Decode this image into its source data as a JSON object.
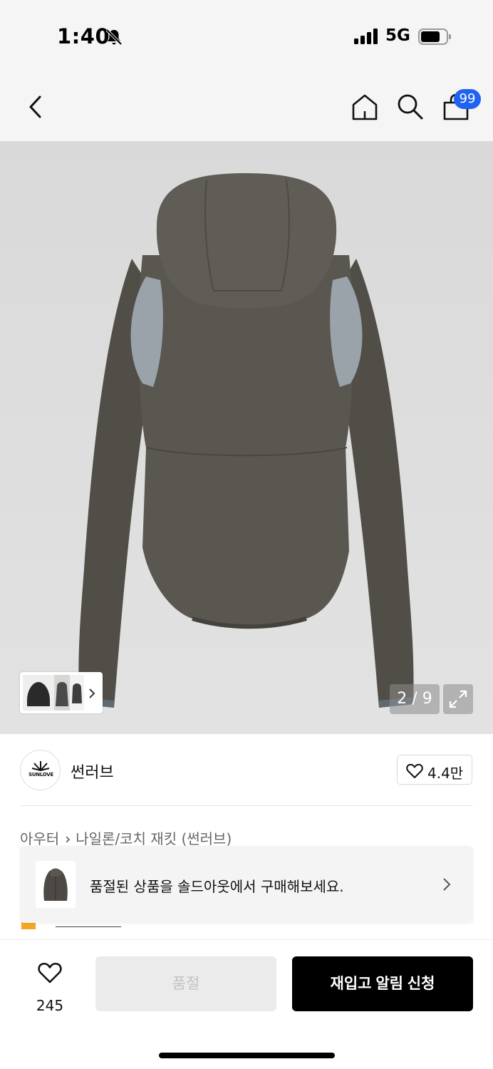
{
  "status_bar": {
    "time": "1:40",
    "network": "5G",
    "icons": [
      "bell-slash-icon",
      "signal-icon",
      "battery-icon"
    ]
  },
  "nav": {
    "icons": [
      "back-icon",
      "home-icon",
      "search-icon",
      "cart-icon"
    ],
    "cart_badge": "99",
    "accent_color": "#1f63f2"
  },
  "gallery": {
    "counter_current": "2",
    "counter_separator": "/",
    "counter_total": "9",
    "icons": [
      "expand-icon",
      "chevron-right-icon"
    ]
  },
  "brand": {
    "logo_text": "SUNLOVE",
    "name": "썬러브",
    "like_count": "4.4만"
  },
  "breadcrumb": {
    "items": [
      "아우터",
      "나일론/코치 재킷 (썬러브)"
    ]
  },
  "soldout_banner": {
    "text": "품절된 상품을 솔드아웃에서 구매해보세요."
  },
  "bottom_bar": {
    "wish_count": "245",
    "soldout_label": "품절",
    "restock_label": "재입고 알림 신청"
  }
}
